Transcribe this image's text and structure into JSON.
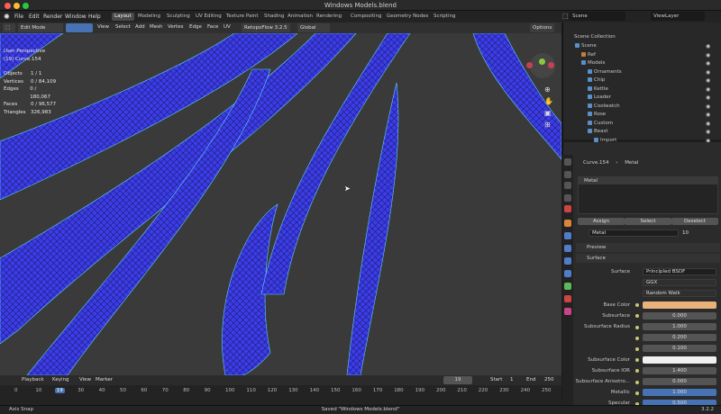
{
  "window": {
    "title": "Windows Models.blend"
  },
  "menu": [
    "File",
    "Edit",
    "Render",
    "Window",
    "Help"
  ],
  "workspaces": [
    "Layout",
    "Modeling",
    "Sculpting",
    "UV Editing",
    "Texture Paint",
    "Shading",
    "Animation",
    "Rendering",
    "Compositing",
    "Geometry Nodes",
    "Scripting"
  ],
  "scene": "Scene",
  "view_layer": "ViewLayer",
  "header": {
    "mode": "Edit Mode",
    "menus": [
      "View",
      "Select",
      "Add",
      "Mesh",
      "Vertex",
      "Edge",
      "Face",
      "UV"
    ],
    "addon": "RetopoFlow 3.2.5",
    "orientation": "Global",
    "options": "Options"
  },
  "viewport": {
    "view_name": "User Perspective",
    "object_name": "(19) Curve.154",
    "stats": [
      [
        "Objects",
        "1 / 1"
      ],
      [
        "Vertices",
        "0 / 84,109"
      ],
      [
        "Edges",
        "0 / 180,067"
      ],
      [
        "Faces",
        "0 / 96,577"
      ],
      [
        "Triangles",
        "326,983"
      ]
    ]
  },
  "outliner": {
    "root": "Scene Collection",
    "items": [
      {
        "name": "Scene",
        "depth": 1,
        "color": "#5b8fc9"
      },
      {
        "name": "Ref",
        "depth": 2,
        "color": "#c87c3a"
      },
      {
        "name": "Models",
        "depth": 2,
        "color": "#5b8fc9"
      },
      {
        "name": "Ornaments",
        "depth": 3,
        "color": "#5b8fc9",
        "badge": "▾"
      },
      {
        "name": "Chip",
        "depth": 3,
        "color": "#5b8fc9",
        "badge": "▾"
      },
      {
        "name": "Kettle",
        "depth": 3,
        "color": "#5b8fc9",
        "badge": "▾"
      },
      {
        "name": "Loader",
        "depth": 3,
        "color": "#5b8fc9",
        "badge": "▾"
      },
      {
        "name": "Coolwatch",
        "depth": 3,
        "color": "#5b8fc9",
        "badge": "▾"
      },
      {
        "name": "Rose",
        "depth": 3,
        "color": "#5b8fc9",
        "badge": "▾"
      },
      {
        "name": "Custom",
        "depth": 3,
        "color": "#5b8fc9",
        "badge": "▾"
      },
      {
        "name": "Beast",
        "depth": 3,
        "color": "#5b8fc9"
      },
      {
        "name": "Import",
        "depth": 4,
        "color": "#5b8fc9"
      }
    ]
  },
  "properties": {
    "object": "Curve.154",
    "material": "Metal",
    "slot": "Metal",
    "assign": "Assign",
    "select": "Select",
    "deselect": "Deselect",
    "mat_users": "10",
    "preview": "Preview",
    "surface_panel": "Surface",
    "rows": [
      {
        "label": "Surface",
        "value": "Principled BSDF",
        "kind": "node"
      },
      {
        "label": "",
        "value": "GGX",
        "kind": "drop"
      },
      {
        "label": "",
        "value": "Random Walk",
        "kind": "drop"
      },
      {
        "label": "Base Color",
        "value": "",
        "kind": "color",
        "color": "#e8b27a"
      },
      {
        "label": "Subsurface",
        "value": "0.000",
        "kind": "num"
      },
      {
        "label": "Subsurface Radius",
        "value": "1.000",
        "kind": "num"
      },
      {
        "label": "",
        "value": "0.200",
        "kind": "num"
      },
      {
        "label": "",
        "value": "0.100",
        "kind": "num"
      },
      {
        "label": "Subsurface Color",
        "value": "",
        "kind": "color",
        "color": "#f0f0f0"
      },
      {
        "label": "Subsurface IOR",
        "value": "1.400",
        "kind": "num"
      },
      {
        "label": "Subsurface Anisotro...",
        "value": "0.000",
        "kind": "num"
      },
      {
        "label": "Metallic",
        "value": "1.000",
        "kind": "blue"
      },
      {
        "label": "Specular",
        "value": "0.500",
        "kind": "blue"
      }
    ]
  },
  "timeline": {
    "menus": [
      "Playback",
      "Keying",
      "View",
      "Marker"
    ],
    "current": "19",
    "start_label": "Start",
    "start": "1",
    "end_label": "End",
    "end": "250",
    "ticks": [
      "0",
      "10",
      "19",
      "30",
      "40",
      "50",
      "60",
      "70",
      "80",
      "90",
      "100",
      "110",
      "120",
      "130",
      "140",
      "150",
      "160",
      "170",
      "180",
      "190",
      "200",
      "210",
      "220",
      "230",
      "240",
      "250"
    ]
  },
  "status": {
    "left": "Axis Snap",
    "center": "Saved \"Windows Models.blend\"",
    "version": "3.2.2"
  }
}
